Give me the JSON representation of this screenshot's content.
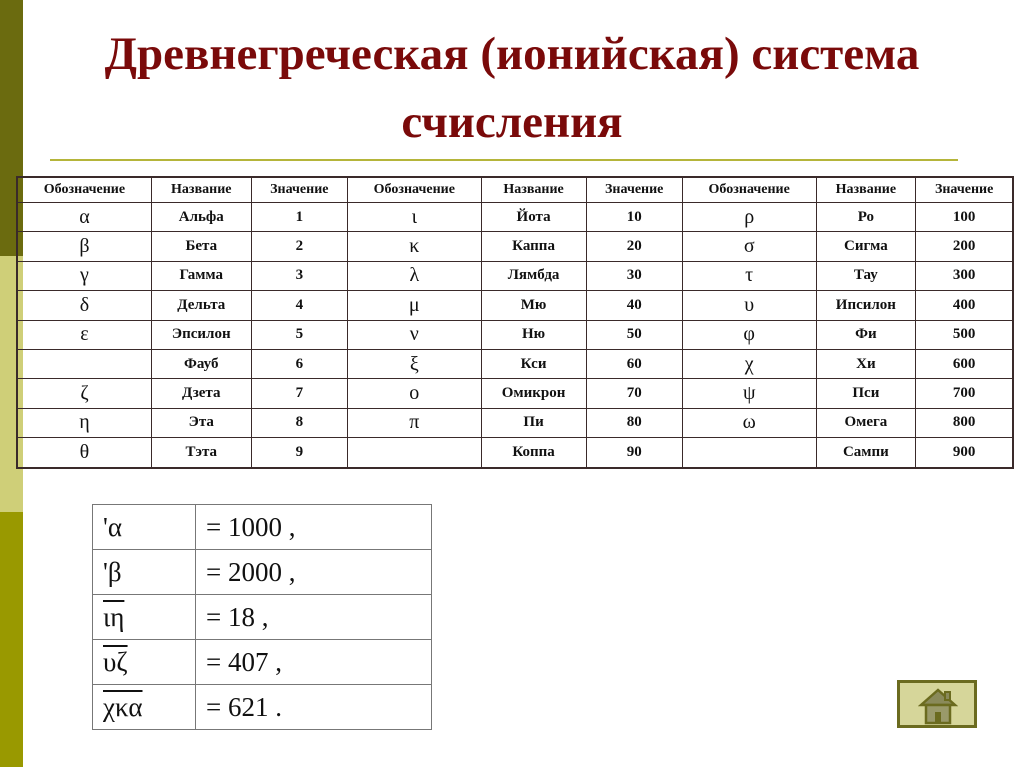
{
  "title": {
    "line1": "Древнегреческая (ионийская) система",
    "line2": "счисления"
  },
  "table": {
    "headers": [
      "Обозначение",
      "Название",
      "Значение",
      "Обозначение",
      "Название",
      "Значение",
      "Обозначение",
      "Название",
      "Значение"
    ],
    "rows": [
      [
        "α",
        "Альфа",
        "1",
        "ι",
        "Йота",
        "10",
        "ρ",
        "Ро",
        "100"
      ],
      [
        "β",
        "Бета",
        "2",
        "κ",
        "Каппа",
        "20",
        "σ",
        "Сигма",
        "200"
      ],
      [
        "γ",
        "Гамма",
        "3",
        "λ",
        "Лямбда",
        "30",
        "τ",
        "Тау",
        "300"
      ],
      [
        "δ",
        "Дельта",
        "4",
        "μ",
        "Мю",
        "40",
        "υ",
        "Ипсилон",
        "400"
      ],
      [
        "ε",
        "Эпсилон",
        "5",
        "ν",
        "Ню",
        "50",
        "φ",
        "Фи",
        "500"
      ],
      [
        "",
        "Фауб",
        "6",
        "ξ",
        "Кси",
        "60",
        "χ",
        "Хи",
        "600"
      ],
      [
        "ζ",
        "Дзета",
        "7",
        "ο",
        "Омикрон",
        "70",
        "ψ",
        "Пси",
        "700"
      ],
      [
        "η",
        "Эта",
        "8",
        "π",
        "Пи",
        "80",
        "ω",
        "Омега",
        "800"
      ],
      [
        "θ",
        "Тэта",
        "9",
        "",
        "Коппа",
        "90",
        "",
        "Сампи",
        "900"
      ]
    ]
  },
  "examples": [
    {
      "notation": "'α",
      "value": "= 1000 ,",
      "overline": false
    },
    {
      "notation": "'β",
      "value": "= 2000 ,",
      "overline": false
    },
    {
      "notation": "ιη",
      "value": "= 18 ,",
      "overline": true
    },
    {
      "notation": "υζ",
      "value": "= 407 ,",
      "overline": true
    },
    {
      "notation": "χκα",
      "value": "= 621 .",
      "overline": true
    }
  ],
  "home_button": {
    "icon": "home-icon"
  },
  "colors": {
    "title": "#7a0a0a",
    "accent_dark": "#6b6b0f",
    "accent_light": "#cfcf78",
    "accent_mid": "#999900"
  }
}
